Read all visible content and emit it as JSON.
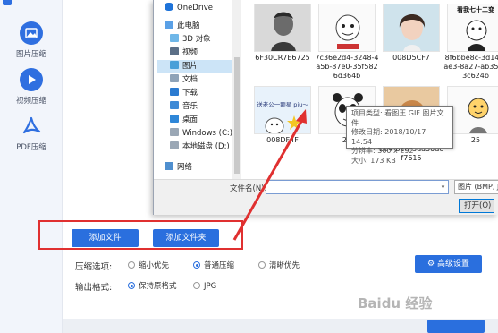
{
  "sidebar": {
    "items": [
      {
        "label": "图片压缩"
      },
      {
        "label": "视频压缩"
      },
      {
        "label": "PDF压缩"
      }
    ]
  },
  "dialog": {
    "nav_items": [
      "OneDrive",
      "此电脑",
      "3D 对象",
      "视频",
      "图片",
      "文档",
      "下载",
      "音乐",
      "桌面",
      "Windows (C:)",
      "本地磁盘 (D:)",
      "网络"
    ],
    "thumb_captions": [
      "看我七十二变",
      "送老公一颗星 piu～"
    ],
    "files": [
      {
        "name": "6F30CR7E6725"
      },
      {
        "name": "7c36e2d4-3248-4a5b-87e0-35f5826d364b"
      },
      {
        "name": "008D5CF7"
      },
      {
        "name": "8f6bbe8c-3d14-4ae3-8a27-ab35d63c624b"
      },
      {
        "name": "008DF4F"
      },
      {
        "name": "21"
      },
      {
        "name": "21e9ddee-82d2-42d4-b2ff-3da50dcf7615"
      },
      {
        "name": "25"
      }
    ],
    "tooltip": {
      "type": "项目类型: 看图王 GIF 图片文件",
      "modified": "修改日期: 2018/10/17 14:54",
      "resolution": "分辨率: 300 x 292",
      "size": "大小: 173 KB"
    },
    "filename_label": "文件名(N):",
    "filename_value": "",
    "filter": "图片 (BMP, JPG...",
    "open_button": "打开(O)"
  },
  "app": {
    "add_file_button": "添加文件",
    "add_folder_button": "添加文件夹",
    "compress_label": "压缩选项:",
    "compress_options": [
      {
        "label": "缩小优先",
        "checked": false
      },
      {
        "label": "普通压缩",
        "checked": true
      },
      {
        "label": "清晰优先",
        "checked": false
      }
    ],
    "advanced_button": "高级设置",
    "format_label": "输出格式:",
    "format_options": [
      {
        "label": "保持原格式",
        "checked": true
      },
      {
        "label": "JPG",
        "checked": false
      }
    ]
  },
  "watermark": "Baidu 经验",
  "colors": {
    "accent": "#2a6fde",
    "annotation": "#e03030"
  }
}
